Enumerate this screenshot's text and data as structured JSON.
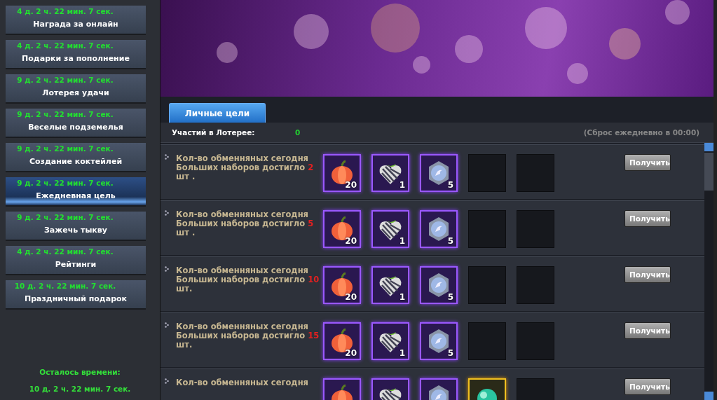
{
  "sidebar": {
    "items": [
      {
        "timer": "4 д. 2 ч. 22 мин. 7 сек.",
        "label": "Награда за онлайн",
        "selected": false
      },
      {
        "timer": "4 д. 2 ч. 22 мин. 7 сек.",
        "label": "Подарки за пополнение",
        "selected": false
      },
      {
        "timer": "9 д. 2 ч. 22 мин. 7 сек.",
        "label": "Лотерея удачи",
        "selected": false
      },
      {
        "timer": "9 д. 2 ч. 22 мин. 7 сек.",
        "label": "Веселые подземелья",
        "selected": false
      },
      {
        "timer": "9 д. 2 ч. 22 мин. 7 сек.",
        "label": "Создание коктейлей",
        "selected": false
      },
      {
        "timer": "9 д. 2 ч. 22 мин. 7 сек.",
        "label": "Ежедневная цель",
        "selected": true
      },
      {
        "timer": "9 д. 2 ч. 22 мин. 7 сек.",
        "label": "Зажечь тыкву",
        "selected": false
      },
      {
        "timer": "4 д. 2 ч. 22 мин. 7 сек.",
        "label": "Рейтинги",
        "selected": false
      },
      {
        "timer": "10 д. 2 ч. 22 мин. 7 сек.",
        "label": "Праздничный подарок",
        "selected": false
      }
    ],
    "remaining_label": "Осталось времени:",
    "remaining_value": "10 д. 2 ч. 22 мин. 7 сек."
  },
  "tabs": [
    {
      "label": "Личные цели",
      "selected": true
    }
  ],
  "info": {
    "label": "Участий в Лотерее:",
    "value": "0",
    "note": "(Сброс ежедневно в 00:00)"
  },
  "goals": [
    {
      "text": "Кол-во обменняных сегодня Больших наборов достигло ",
      "count": "2",
      "suffix": " шт .",
      "rewards": [
        {
          "kind": "pumpkin",
          "count": "20"
        },
        {
          "kind": "gift",
          "count": "1"
        },
        {
          "kind": "medal",
          "count": "5"
        },
        {
          "kind": "empty"
        },
        {
          "kind": "empty"
        }
      ],
      "button": "Получить"
    },
    {
      "text": "Кол-во обменняных сегодня Больших наборов достигло ",
      "count": "5",
      "suffix": " шт .",
      "rewards": [
        {
          "kind": "pumpkin",
          "count": "20"
        },
        {
          "kind": "gift",
          "count": "1"
        },
        {
          "kind": "medal",
          "count": "5"
        },
        {
          "kind": "empty"
        },
        {
          "kind": "empty"
        }
      ],
      "button": "Получить"
    },
    {
      "text": "Кол-во обменняных сегодня Больших наборов достигло ",
      "count": "10",
      "suffix": " шт.",
      "rewards": [
        {
          "kind": "pumpkin",
          "count": "20"
        },
        {
          "kind": "gift",
          "count": "1"
        },
        {
          "kind": "medal",
          "count": "5"
        },
        {
          "kind": "empty"
        },
        {
          "kind": "empty"
        }
      ],
      "button": "Получить"
    },
    {
      "text": "Кол-во обменняных сегодня Больших наборов достигло ",
      "count": "15",
      "suffix": " шт.",
      "rewards": [
        {
          "kind": "pumpkin",
          "count": "20"
        },
        {
          "kind": "gift",
          "count": "1"
        },
        {
          "kind": "medal",
          "count": "5"
        },
        {
          "kind": "empty"
        },
        {
          "kind": "empty"
        }
      ],
      "button": "Получить"
    },
    {
      "text": "Кол-во обменняных сегодня",
      "rewards": [
        {
          "kind": "pumpkin"
        },
        {
          "kind": "gift"
        },
        {
          "kind": "medal"
        },
        {
          "kind": "orb"
        },
        {
          "kind": "empty"
        }
      ],
      "button": "Получить"
    }
  ]
}
